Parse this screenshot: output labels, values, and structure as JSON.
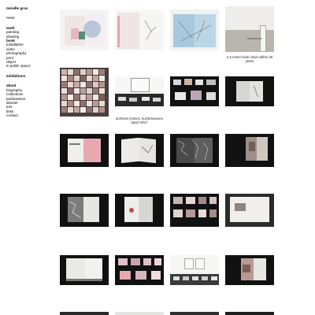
{
  "sidebar": {
    "name": "mireille gros",
    "news": "news",
    "work": {
      "title": "work",
      "items": [
        "painting",
        "drawing",
        "book",
        "installation",
        "video",
        "photography",
        "print",
        "object",
        "in public space"
      ],
      "active": "book"
    },
    "exhibitions": "exhibitions",
    "about": {
      "title": "about",
      "items": [
        "biography",
        "collections",
        "publications",
        "dossier",
        "text",
        "links",
        "contact"
      ]
    }
  },
  "gallery": {
    "captions": {
      "tile_4": "a 5 meter book chain within 30 years",
      "tile_6": "archives intimes, kunstmuseum basel 2017"
    }
  },
  "colors": {
    "background": "#ffffff",
    "dark_tile": "#111111",
    "paper": "#f3f1ec",
    "accent_pink": "#e7a7b0",
    "accent_blue": "#8fb7d2"
  }
}
